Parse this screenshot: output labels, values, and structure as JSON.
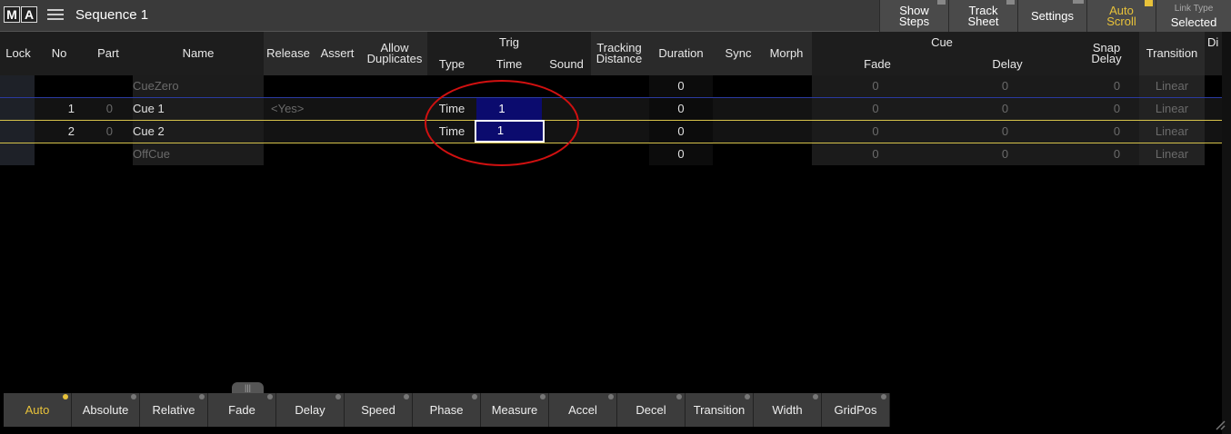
{
  "titlebar": {
    "logo_left": "M",
    "logo_right": "A",
    "title": "Sequence 1",
    "buttons": [
      {
        "label": "Show\nSteps"
      },
      {
        "label": "Track\nSheet"
      },
      {
        "label": "Settings"
      },
      {
        "label": "Auto\nScroll"
      },
      {
        "small": "Link Type",
        "label": "Selected"
      }
    ]
  },
  "columns": {
    "lock": "Lock",
    "no": "No",
    "part": "Part",
    "name": "Name",
    "release": "Release",
    "assert": "Assert",
    "allow_dup": "Allow\nDuplicates",
    "trig": "Trig",
    "trig_type": "Type",
    "trig_time": "Time",
    "sound": "Sound",
    "tracking": "Tracking\nDistance",
    "duration": "Duration",
    "sync": "Sync",
    "morph": "Morph",
    "cue": "Cue",
    "fade": "Fade",
    "delay": "Delay",
    "snap_delay": "Snap\nDelay",
    "transition": "Transition",
    "di": "Di"
  },
  "rows": [
    {
      "no": "",
      "part": "",
      "name": "CueZero",
      "release": "",
      "trig_type": "",
      "trig_time": "",
      "duration": "0",
      "fade": "0",
      "delay": "0",
      "snap": "0",
      "transition": "Linear"
    },
    {
      "no": "1",
      "part": "0",
      "name": "Cue  1",
      "release": "<Yes>",
      "trig_type": "Time",
      "trig_time": "1",
      "duration": "0",
      "fade": "0",
      "delay": "0",
      "snap": "0",
      "transition": "Linear"
    },
    {
      "no": "2",
      "part": "0",
      "name": "Cue  2",
      "release": "",
      "trig_type": "Time",
      "trig_time": "1",
      "duration": "0",
      "fade": "0",
      "delay": "0",
      "snap": "0",
      "transition": "Linear"
    },
    {
      "no": "",
      "part": "",
      "name": "OffCue",
      "release": "",
      "trig_type": "",
      "trig_time": "",
      "duration": "0",
      "fade": "0",
      "delay": "0",
      "snap": "0",
      "transition": "Linear"
    }
  ],
  "bottom_buttons": [
    "Auto",
    "Absolute",
    "Relative",
    "Fade",
    "Delay",
    "Speed",
    "Phase",
    "Measure",
    "Accel",
    "Decel",
    "Transition",
    "Width",
    "GridPos"
  ],
  "grip": "|||",
  "colors": {
    "accent": "#e8c23a",
    "selection": "#0b0b6e",
    "annotation": "#d01010"
  }
}
